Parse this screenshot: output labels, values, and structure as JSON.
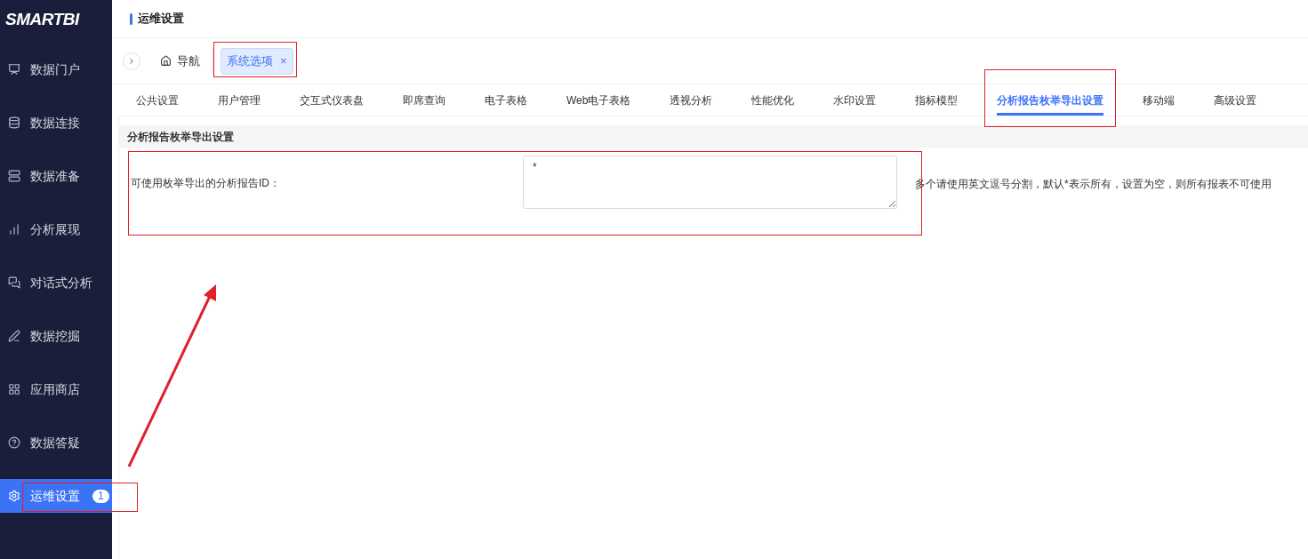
{
  "sidebar": {
    "logo": "SMARTBI",
    "items": [
      {
        "label": "数据门户",
        "selected": false
      },
      {
        "label": "数据连接",
        "selected": false
      },
      {
        "label": "数据准备",
        "selected": false
      },
      {
        "label": "分析展现",
        "selected": false
      },
      {
        "label": "对话式分析",
        "selected": false
      },
      {
        "label": "数据挖掘",
        "selected": false
      },
      {
        "label": "应用商店",
        "selected": false
      },
      {
        "label": "数据答疑",
        "selected": false
      },
      {
        "label": "运维设置",
        "selected": true,
        "badge": "1"
      }
    ]
  },
  "header": {
    "title": "运维设置"
  },
  "page_tabs": [
    {
      "label": "导航",
      "selected": false,
      "kind": "home"
    },
    {
      "label": "系统选项",
      "selected": true,
      "kind": "closable",
      "close": "×"
    }
  ],
  "settings_tabs": [
    {
      "label": "公共设置",
      "selected": false
    },
    {
      "label": "用户管理",
      "selected": false
    },
    {
      "label": "交互式仪表盘",
      "selected": false
    },
    {
      "label": "即席查询",
      "selected": false
    },
    {
      "label": "电子表格",
      "selected": false
    },
    {
      "label": "Web电子表格",
      "selected": false
    },
    {
      "label": "透视分析",
      "selected": false
    },
    {
      "label": "性能优化",
      "selected": false
    },
    {
      "label": "水印设置",
      "selected": false
    },
    {
      "label": "指标模型",
      "selected": false
    },
    {
      "label": "分析报告枚举导出设置",
      "selected": true
    },
    {
      "label": "移动端",
      "selected": false
    },
    {
      "label": "高级设置",
      "selected": false
    }
  ],
  "section": {
    "title": "分析报告枚举导出设置",
    "fields": [
      {
        "label": "可使用枚举导出的分析报告ID：",
        "value": "*",
        "hint": "多个请使用英文逗号分割，默认*表示所有，设置为空，则所有报表不可使用"
      }
    ]
  }
}
